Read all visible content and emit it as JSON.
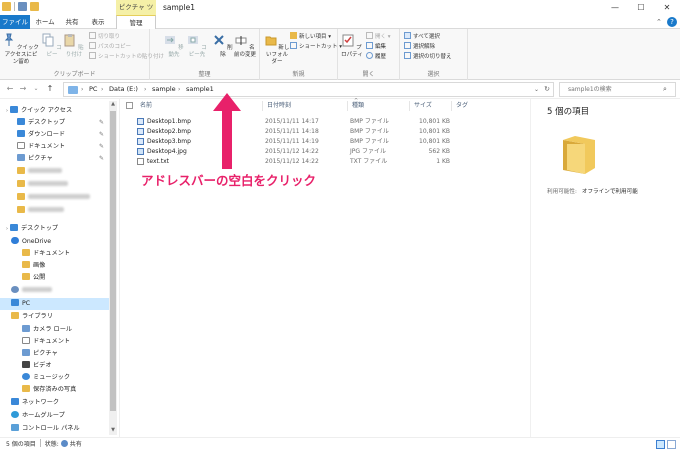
{
  "window": {
    "title": "sample1",
    "context_tab": "ピクチャ ツール",
    "controls": {
      "minimize": "—",
      "maximize": "☐",
      "close": "✕"
    }
  },
  "ribbon_tabs": {
    "file": "ファイル",
    "home": "ホーム",
    "share": "共有",
    "view": "表示",
    "manage": "管理",
    "help": "?"
  },
  "ribbon": {
    "clipboard": {
      "pin_label": "クイック アクセスにピン留め",
      "copy_label": "コピー",
      "paste_label": "貼り付け",
      "cut_label": "切り取り",
      "copy_path_label": "パスのコピー",
      "paste_shortcut_label": "ショートカットの貼り付け",
      "group_label": "クリップボード"
    },
    "organize": {
      "move_to_label": "移動先",
      "copy_to_label": "コピー先",
      "delete_label": "削除",
      "rename_label": "名前の変更",
      "group_label": "整理"
    },
    "new": {
      "new_folder_label": "新しいフォルダー",
      "new_item_label": "新しい項目 ▾",
      "shortcut_label": "ショートカット ▾",
      "group_label": "新規"
    },
    "open": {
      "properties_label": "プロパティ",
      "open_label": "開く ▾",
      "edit_label": "編集",
      "history_label": "履歴",
      "group_label": "開く"
    },
    "select": {
      "select_all_label": "すべて選択",
      "select_none_label": "選択解除",
      "invert_label": "選択の切り替え",
      "group_label": "選択"
    }
  },
  "address": {
    "back": "←",
    "forward": "→",
    "recent": "⌄",
    "up": "↑",
    "crumbs": [
      "PC",
      "Data (E:)",
      "sample",
      "sample1"
    ],
    "dropdown": "⌄",
    "refresh": "↻",
    "search_placeholder": "sample1の検索",
    "search_icon": "magnifier-icon"
  },
  "nav": {
    "quick_access": "クイック アクセス",
    "desktop": "デスクトップ",
    "downloads": "ダウンロード",
    "documents": "ドキュメント",
    "pictures": "ピクチャ",
    "desktop2": "デスクトップ",
    "onedrive": "OneDrive",
    "od_documents": "ドキュメント",
    "od_pictures": "画像",
    "od_public": "公開",
    "pc": "PC",
    "libraries": "ライブラリ",
    "camera_roll": "カメラ ロール",
    "lib_documents": "ドキュメント",
    "lib_pictures": "ピクチャ",
    "lib_videos": "ビデオ",
    "lib_music": "ミュージック",
    "saved_pictures": "保存済みの写真",
    "network": "ネットワーク",
    "homegroup": "ホームグループ",
    "control_panel": "コントロール パネル",
    "pin_glyph": "✎"
  },
  "list": {
    "columns": {
      "name": "名前",
      "date": "日付時刻",
      "type": "種類",
      "size": "サイズ",
      "tag": "タグ"
    },
    "sort_glyph": "^",
    "files": [
      {
        "name": "Desktop1.bmp",
        "date": "2015/11/11 14:17",
        "type": "BMP ファイル",
        "size": "10,801 KB",
        "kind": "bmp"
      },
      {
        "name": "Desktop2.bmp",
        "date": "2015/11/11 14:18",
        "type": "BMP ファイル",
        "size": "10,801 KB",
        "kind": "bmp"
      },
      {
        "name": "Desktop3.bmp",
        "date": "2015/11/11 14:19",
        "type": "BMP ファイル",
        "size": "10,801 KB",
        "kind": "bmp"
      },
      {
        "name": "Desktop4.jpg",
        "date": "2015/11/12 14:22",
        "type": "JPG ファイル",
        "size": "562 KB",
        "kind": "jpg"
      },
      {
        "name": "text.txt",
        "date": "2015/11/12 14:22",
        "type": "TXT ファイル",
        "size": "1 KB",
        "kind": "txt"
      }
    ]
  },
  "annotation": {
    "text": "アドレスバーの空白をクリック",
    "color": "#e8216a"
  },
  "details": {
    "title": "5 個の項目",
    "availability_label": "利用可能性:",
    "availability_value": "オフラインで利用可能"
  },
  "status": {
    "count": "5 個の項目",
    "state_label": "状態:",
    "state_value": "共有"
  },
  "colors": {
    "accent": "#1979ca",
    "folder": "#e9b949",
    "selected": "#cce8ff"
  }
}
